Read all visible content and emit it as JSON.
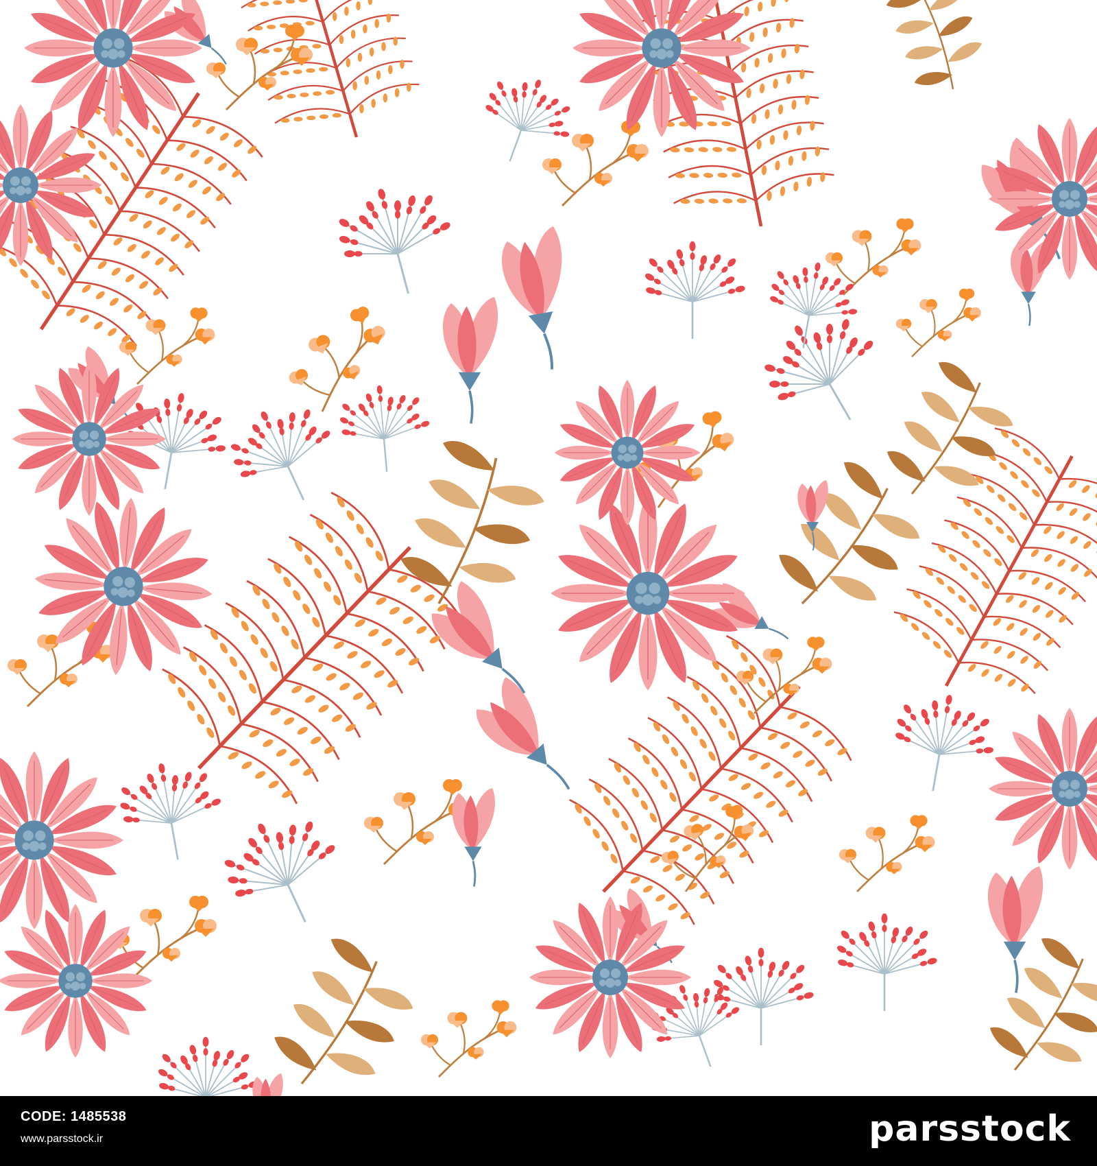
{
  "artwork": {
    "description_icons": [
      "pink-daisy-icon",
      "pink-bud-icon",
      "red-berry-umbel-icon",
      "orange-blossom-sprig-icon",
      "coral-fern-branch-icon",
      "tan-leaf-stem-icon"
    ],
    "colors": {
      "background": "#ffffff",
      "petal_light": "#f6a3a6",
      "petal_dark": "#ec6f78",
      "center": "#5e89a8",
      "berry": "#e8474b",
      "umbel_stem": "#a9bfcb",
      "blossom_orange": "#f7902f",
      "blossom_peach": "#f9bb8a",
      "branch_red": "#d24a3c",
      "fern_orange": "#f29a46",
      "leaf_tan": "#e0b07b",
      "leaf_brown": "#b8783a",
      "stem_brown": "#c08040"
    }
  },
  "footer": {
    "code_label": "CODE:",
    "code_value": "1485538",
    "url": "www.parsstock.ir",
    "brand": "parsstock"
  }
}
